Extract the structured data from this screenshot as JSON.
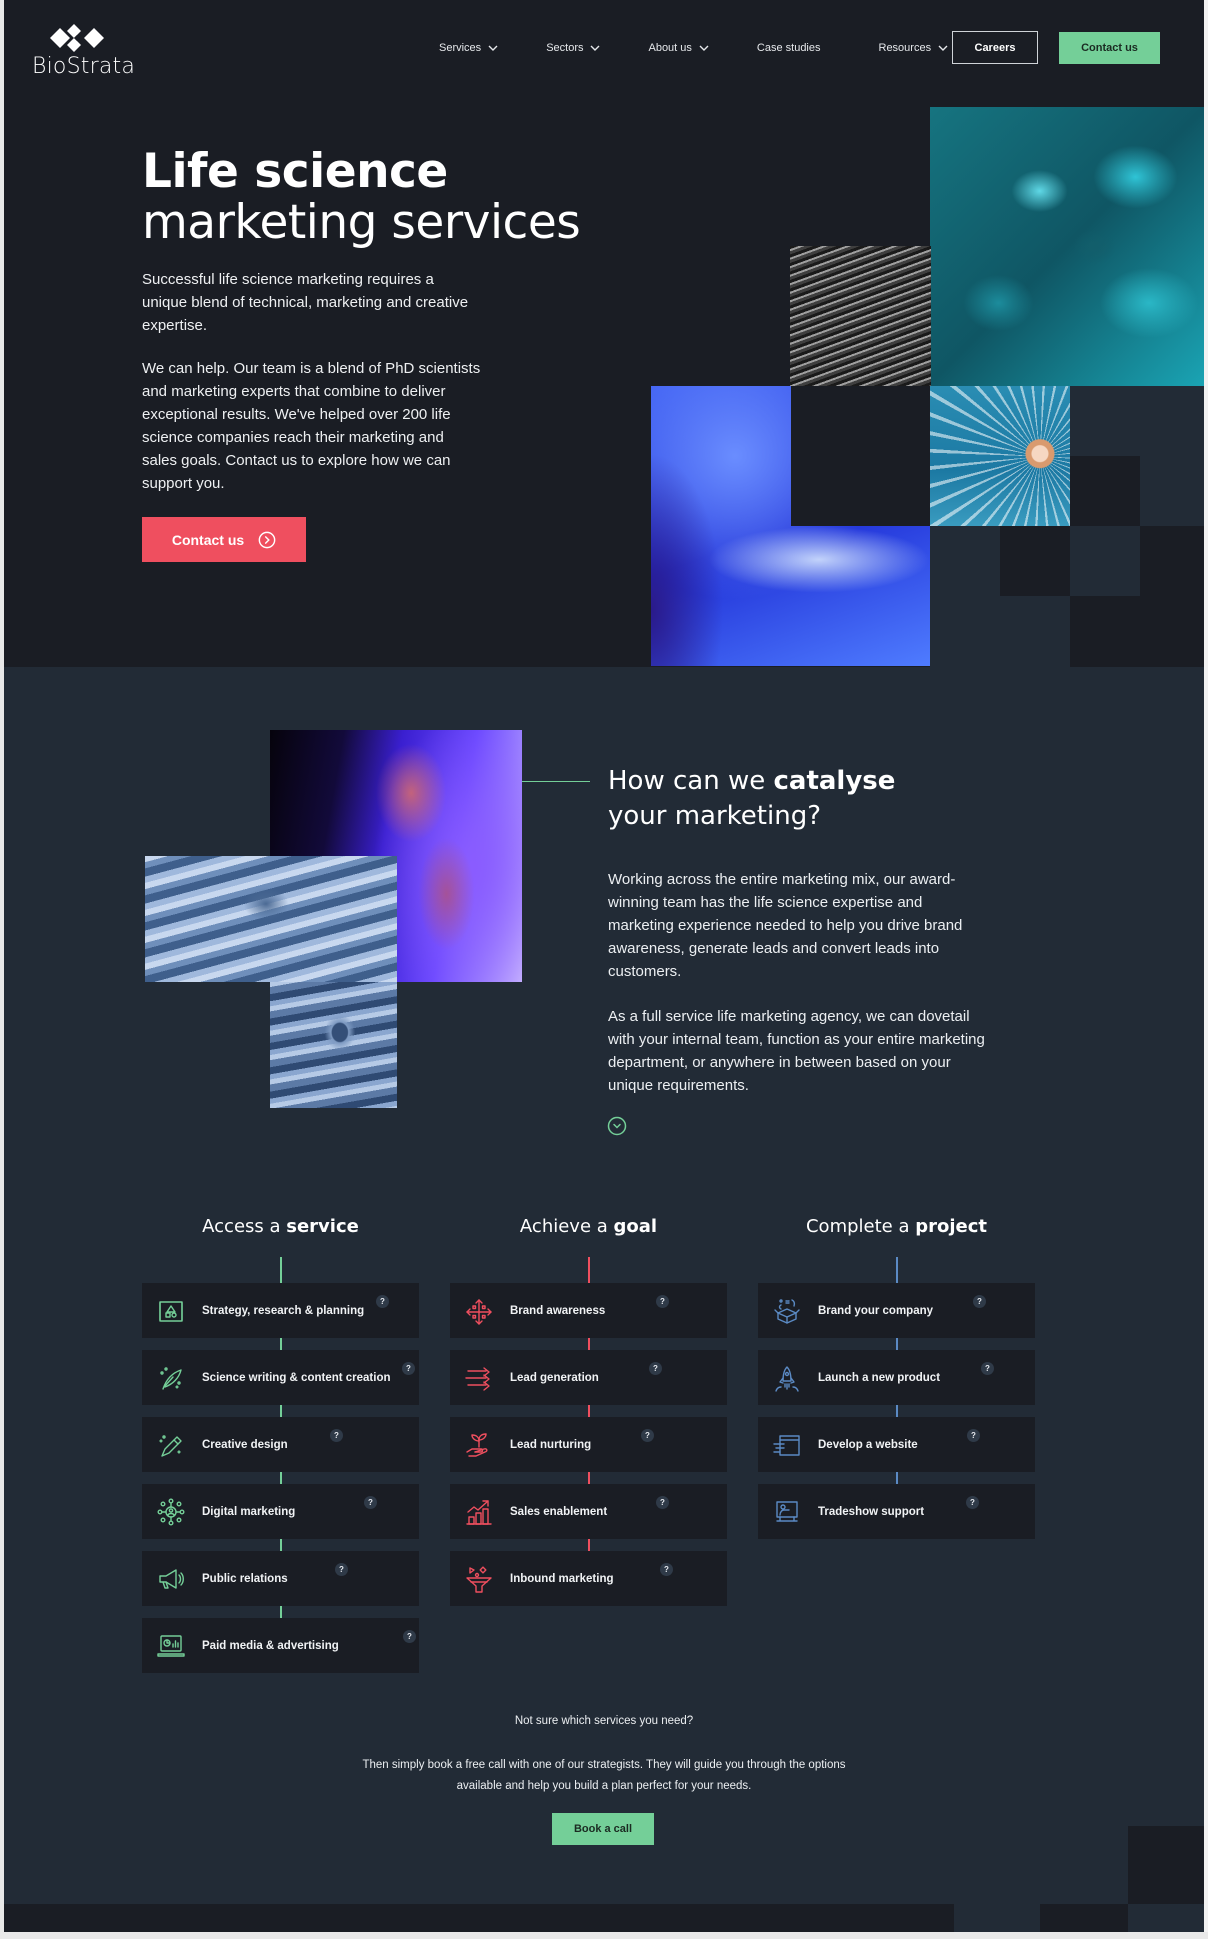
{
  "brand": {
    "name": "BioStrata"
  },
  "nav": {
    "items": [
      {
        "label": "Services",
        "has_dropdown": true
      },
      {
        "label": "Sectors",
        "has_dropdown": true
      },
      {
        "label": "About us",
        "has_dropdown": true
      },
      {
        "label": "Case studies",
        "has_dropdown": false
      },
      {
        "label": "Resources",
        "has_dropdown": true
      }
    ],
    "careers_label": "Careers",
    "contact_label": "Contact us"
  },
  "hero": {
    "title_line1": "Life science",
    "title_line2": "marketing services",
    "paragraph1": "Successful life science marketing requires a unique blend of technical, marketing and creative expertise.",
    "paragraph2": "We can help. Our team is a blend of PhD scientists and marketing experts that combine to deliver exceptional results. We've helped over 200 life science companies reach their marketing and sales goals. Contact us to explore how we can support you.",
    "cta_label": "Contact us",
    "cta_icon": "arrow-right-circle-icon"
  },
  "catalyse": {
    "title_pre": "How can we ",
    "title_bold": "catalyse",
    "title_post": "your marketing?",
    "paragraph1": "Working across the entire marketing mix, our award-winning team has the life science expertise and marketing experience needed to help you drive brand awareness, generate leads and convert leads into customers.",
    "paragraph2": "As a full service life marketing agency, we can dovetail with your internal team, function as your entire marketing department, or anywhere in between based on your unique requirements.",
    "scroll_icon": "chevron-down-circle-icon"
  },
  "colors": {
    "accent_green": "#74cf98",
    "accent_red": "#ef4f5f",
    "accent_blue": "#5b8ac4",
    "hero_bg": "#1a1d24",
    "section_bg": "#222b36",
    "card_bg": "#1a1d24"
  },
  "columns": [
    {
      "title_pre": "Access a ",
      "title_bold": "service",
      "color": "#74cf98",
      "items": [
        {
          "label": "Strategy, research & planning",
          "icon": "blueprint-icon"
        },
        {
          "label": "Science writing & content creation",
          "icon": "quill-icon"
        },
        {
          "label": "Creative design",
          "icon": "pencil-icon"
        },
        {
          "label": "Digital marketing",
          "icon": "network-icon"
        },
        {
          "label": "Public relations",
          "icon": "megaphone-icon"
        },
        {
          "label": "Paid media & advertising",
          "icon": "laptop-chart-icon"
        }
      ]
    },
    {
      "title_pre": "Achieve a ",
      "title_bold": "goal",
      "color": "#ef4f5f",
      "items": [
        {
          "label": "Brand awareness",
          "icon": "expand-arrows-icon"
        },
        {
          "label": "Lead generation",
          "icon": "fast-arrows-icon"
        },
        {
          "label": "Lead nurturing",
          "icon": "plant-hand-icon"
        },
        {
          "label": "Sales enablement",
          "icon": "growth-chart-icon"
        },
        {
          "label": "Inbound marketing",
          "icon": "funnel-icon"
        }
      ]
    },
    {
      "title_pre": "Complete a ",
      "title_bold": "project",
      "color": "#5b8ac4",
      "items": [
        {
          "label": "Brand your company",
          "icon": "open-box-icon"
        },
        {
          "label": "Launch a new product",
          "icon": "rocket-icon"
        },
        {
          "label": "Develop a website",
          "icon": "browser-window-icon"
        },
        {
          "label": "Tradeshow support",
          "icon": "presenter-icon"
        }
      ]
    }
  ],
  "help_glyph": "?",
  "cta": {
    "question": "Not sure which services you need?",
    "paragraph": "Then simply book a free call with one of our strategists. They will guide you through the options available and help you build a plan perfect for your needs.",
    "button_label": "Book a call"
  }
}
